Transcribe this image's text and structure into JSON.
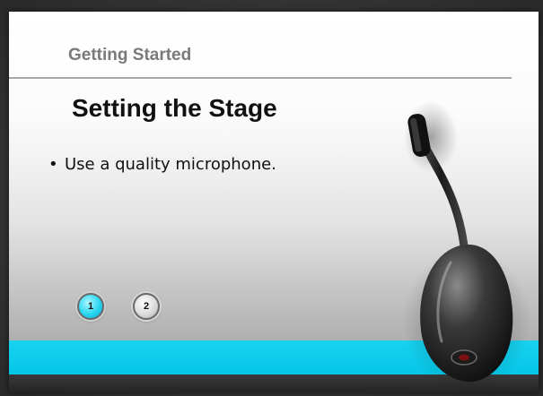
{
  "slide": {
    "section_title": "Getting Started",
    "title": "Setting the Stage",
    "bullets": [
      "Use a quality microphone."
    ]
  },
  "navigation": {
    "buttons": [
      {
        "label": "1",
        "state": "active"
      },
      {
        "label": "2",
        "state": "inactive"
      }
    ]
  },
  "colors": {
    "accent_bar": "#05c6e8",
    "active_button": "#29d6f0",
    "bottom_bar": "#2a2a2a"
  },
  "icons": {
    "illustration": "headset-microphone-image"
  }
}
